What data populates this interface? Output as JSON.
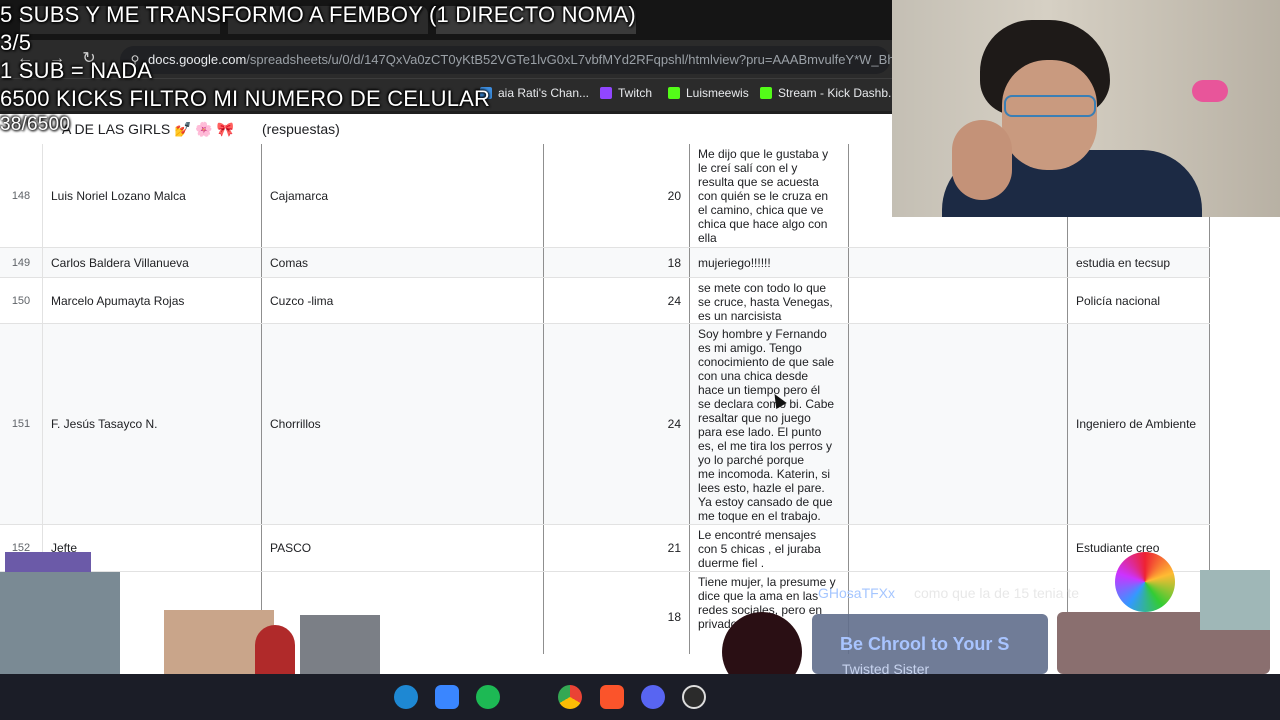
{
  "overlay": {
    "line1": "5 SUBS Y ME TRANSFORMO A FEMBOY (1 DIRECTO NOMA)",
    "line2": "3/5",
    "line3": "1 SUB = NADA",
    "line4": "6500 KICKS FILTRO MI NUMERO DE CELULAR",
    "line5": "38/6500"
  },
  "browser": {
    "url_host": "docs.google.com",
    "url_path": "/spreadsheets/u/0/d/147QxVa0zCT0yKtB52VGTe1lvG0xL7vbfMYd2RFqpshl/htmlview?pru=AAABmvulfeY*W_Bha",
    "bookmarks": [
      {
        "label": "aia Rati's Chan...",
        "color": "#3c8dde"
      },
      {
        "label": "Twitch",
        "color": "#9146ff"
      },
      {
        "label": "Luismeewis",
        "color": "#53fc18"
      },
      {
        "label": "Stream - Kick Dashb...",
        "color": "#53fc18"
      }
    ]
  },
  "sheet": {
    "title_prefix": "A DE LAS GIRLS 💅 🌸 🎀",
    "title_suffix": "(respuestas)",
    "rows": [
      {
        "num": "148",
        "name": "Luis Noriel Lozano Malca",
        "place": "Cajamarca",
        "age": "20",
        "story": "Me dijo que le gustaba y\nle creí salí con el y\nresulta que se acuesta\ncon quién se le cruza en\nel camino, chica que ve\nchica que hace algo con\nella",
        "occ": ""
      },
      {
        "num": "149",
        "name": "Carlos Baldera Villanueva",
        "place": "Comas",
        "age": "18",
        "story": "mujeriego!!!!!!",
        "occ": "estudia en tecsup"
      },
      {
        "num": "150",
        "name": "Marcelo Apumayta Rojas",
        "place": "Cuzco -lima",
        "age": "24",
        "story": "se mete con todo lo que\nse cruce, hasta Venegas,\nes un narcisista",
        "occ": "Policía nacional"
      },
      {
        "num": "151",
        "name": "F. Jesús Tasayco N.",
        "place": "Chorrillos",
        "age": "24",
        "story": "Soy hombre y Fernando\nes mi amigo. Tengo\nconocimiento de que sale\ncon una chica desde\nhace un tiempo pero él\nse declara como bi. Cabe\nresaltar que no juego\npara ese lado. El punto\nes, el me tira los perros y\nyo lo parché porque\nme incomoda. Katerin, si\nlees esto, hazle el pare.\nYa estoy cansado de que\nme toque en el trabajo.",
        "occ": "Ingeniero de Ambiente"
      },
      {
        "num": "152",
        "name": "Jefte",
        "place": "PASCO",
        "age": "21",
        "story": "Le encontré mensajes\ncon 5 chicas , el juraba\nduerme fiel .",
        "occ": "Estudiante creo"
      },
      {
        "num": "",
        "name": "",
        "place": "",
        "age": "18",
        "story": "Tiene mujer, la presume y\ndice que la ama en las\nredes sociales, pero en\nprivado",
        "occ": ""
      }
    ]
  },
  "stream": {
    "chat_user": "GHosaTFXx",
    "chat_message": "como que la de 15 tenia te",
    "donation_title": "Be Chrool to Your S",
    "donation_subtitle": "Twisted Sister"
  },
  "taskbar": {
    "icons": [
      "edge-icon",
      "store-icon",
      "spotify-icon",
      "chrome-icon",
      "brave-icon",
      "discord-icon",
      "obs-icon"
    ]
  }
}
